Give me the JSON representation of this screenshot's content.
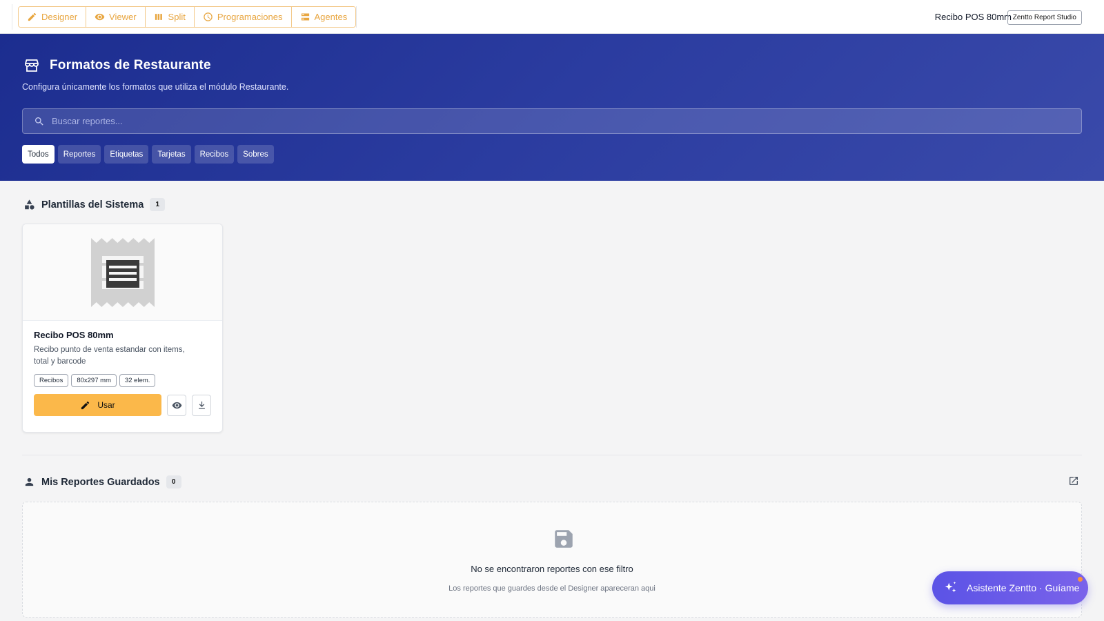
{
  "toolbar": {
    "modes": [
      {
        "label": "Designer",
        "icon": "pencil-icon"
      },
      {
        "label": "Viewer",
        "icon": "eye-icon"
      },
      {
        "label": "Split",
        "icon": "columns-icon"
      },
      {
        "label": "Programaciones",
        "icon": "clock-icon"
      },
      {
        "label": "Agentes",
        "icon": "list-icon"
      }
    ],
    "doc_title": "Recibo POS 80mm",
    "brand": "Zentto Report Studio"
  },
  "hero": {
    "title": "Formatos de Restaurante",
    "subtitle": "Configura únicamente los formatos que utiliza el módulo Restaurante.",
    "search_placeholder": "Buscar reportes...",
    "filters": [
      {
        "label": "Todos",
        "active": true
      },
      {
        "label": "Reportes",
        "active": false
      },
      {
        "label": "Etiquetas",
        "active": false
      },
      {
        "label": "Tarjetas",
        "active": false
      },
      {
        "label": "Recibos",
        "active": false
      },
      {
        "label": "Sobres",
        "active": false
      }
    ]
  },
  "templates": {
    "title": "Plantillas del Sistema",
    "count": "1",
    "items": [
      {
        "title": "Recibo POS 80mm",
        "description": "Recibo punto de venta estandar con items, total y barcode",
        "tags": [
          "Recibos",
          "80x297 mm",
          "32 elem."
        ],
        "use_label": "Usar"
      }
    ]
  },
  "saved": {
    "title": "Mis Reportes Guardados",
    "count": "0",
    "empty_title": "No se encontraron reportes con ese filtro",
    "empty_subtitle": "Los reportes que guardes desde el Designer apareceran aqui"
  },
  "assistant": {
    "label": "Asistente Zentto · Guíame"
  },
  "colors": {
    "accent": "#fbb84a",
    "hero": "#1c2d8f",
    "assistant": "#5b53e6"
  }
}
